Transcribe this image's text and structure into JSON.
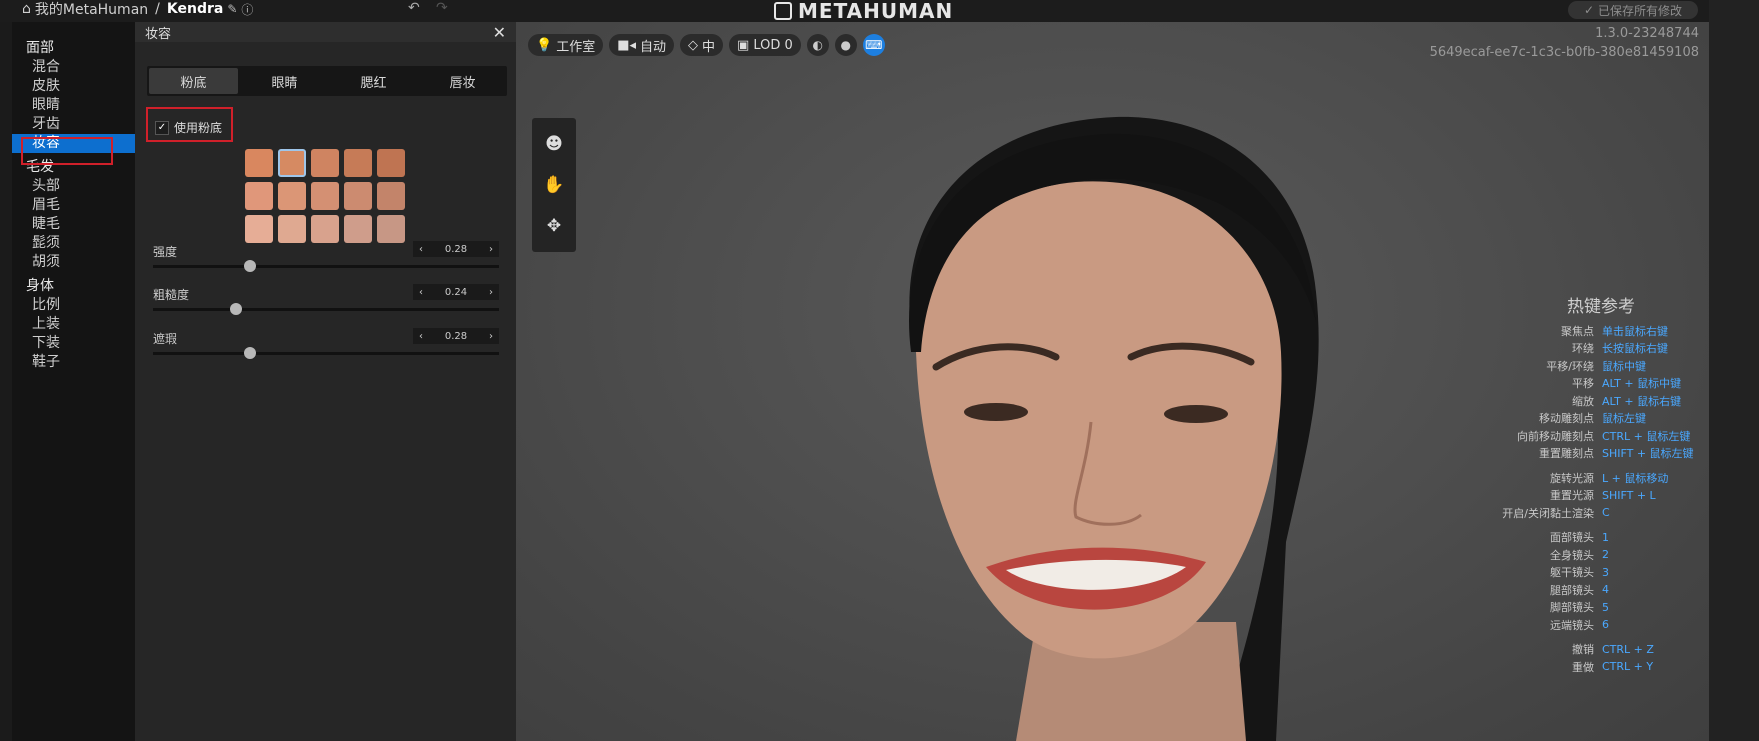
{
  "topbar": {
    "breadcrumb_root": "我的MetaHuman",
    "breadcrumb_sep": "/",
    "character_name": "Kendra",
    "logo_text": "METAHUMAN",
    "saved_status": "已保存所有修改"
  },
  "nav": {
    "groups": [
      {
        "label": "面部",
        "items": [
          "混合",
          "皮肤",
          "眼睛",
          "牙齿",
          "妆容"
        ]
      },
      {
        "label": "毛发",
        "items": [
          "头部",
          "眉毛",
          "睫毛",
          "髭须",
          "胡须"
        ]
      },
      {
        "label": "身体",
        "items": [
          "比例",
          "上装",
          "下装",
          "鞋子"
        ]
      }
    ],
    "active_item": "妆容"
  },
  "panel": {
    "title": "妆容",
    "tabs": [
      "粉底",
      "眼睛",
      "腮红",
      "唇妆"
    ],
    "active_tab": "粉底",
    "use_foundation_label": "使用粉底",
    "use_foundation_checked": true,
    "swatches": [
      [
        "#d9875f",
        "#d68a62",
        "#cf8461",
        "#c67b57",
        "#bf7452"
      ],
      [
        "#e0977a",
        "#db9676",
        "#d49073",
        "#cc8b70",
        "#c3846a"
      ],
      [
        "#e6ad96",
        "#dfa991",
        "#d8a28d",
        "#cf9d8b",
        "#c79785"
      ]
    ],
    "selected_swatch": [
      0,
      1
    ],
    "sliders": [
      {
        "label": "强度",
        "value": "0.28",
        "level": 0.28
      },
      {
        "label": "粗糙度",
        "value": "0.24",
        "level": 0.24
      },
      {
        "label": "遮瑕",
        "value": "0.28",
        "level": 0.28
      }
    ]
  },
  "viewport": {
    "toolbar": {
      "studio": "工作室",
      "auto": "自动",
      "quality": "中",
      "lod": "LOD 0"
    },
    "version": "1.3.0-23248744",
    "build_id": "5649ecaf-ee7c-1c3c-b0fb-380e81459108",
    "hotkeys_title": "热键参考",
    "hotkeys": [
      {
        "action": "聚焦点",
        "key": "单击鼠标右键"
      },
      {
        "action": "环绕",
        "key": "长按鼠标右键"
      },
      {
        "action": "平移/环绕",
        "key": "鼠标中键"
      },
      {
        "action": "平移",
        "key": "ALT + 鼠标中键"
      },
      {
        "action": "缩放",
        "key": "ALT + 鼠标右键"
      },
      {
        "action": "移动雕刻点",
        "key": "鼠标左键"
      },
      {
        "action": "向前移动雕刻点",
        "key": "CTRL + 鼠标左键"
      },
      {
        "action": "重置雕刻点",
        "key": "SHIFT + 鼠标左键"
      },
      {
        "action": "",
        "key": ""
      },
      {
        "action": "旋转光源",
        "key": "L + 鼠标移动"
      },
      {
        "action": "重置光源",
        "key": "SHIFT + L"
      },
      {
        "action": "开启/关闭黏土渲染",
        "key": "C"
      },
      {
        "action": "",
        "key": ""
      },
      {
        "action": "面部镜头",
        "key": "1"
      },
      {
        "action": "全身镜头",
        "key": "2"
      },
      {
        "action": "躯干镜头",
        "key": "3"
      },
      {
        "action": "腿部镜头",
        "key": "4"
      },
      {
        "action": "脚部镜头",
        "key": "5"
      },
      {
        "action": "远端镜头",
        "key": "6"
      },
      {
        "action": "",
        "key": ""
      },
      {
        "action": "撤销",
        "key": "CTRL + Z"
      },
      {
        "action": "重做",
        "key": "CTRL + Y"
      }
    ]
  }
}
